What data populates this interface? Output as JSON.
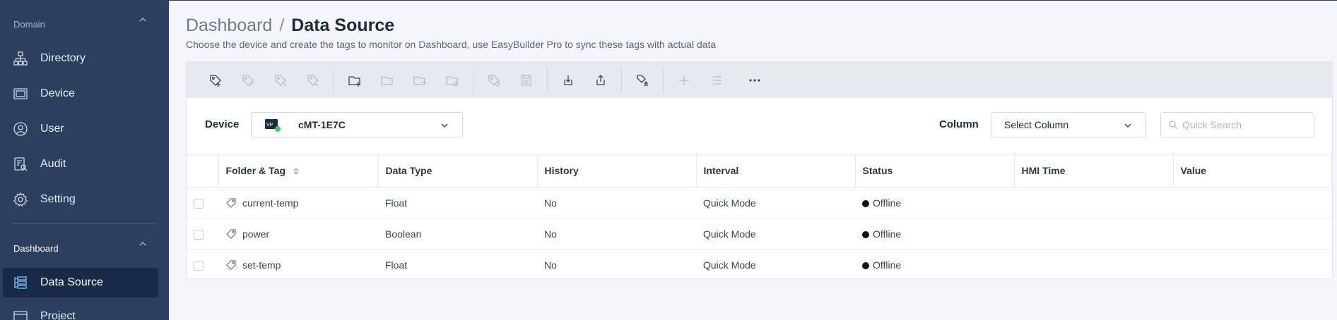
{
  "sidebar": {
    "domain_section": "Domain",
    "dashboard_section": "Dashboard",
    "items": [
      {
        "label": "Directory",
        "icon": "directory-icon"
      },
      {
        "label": "Device",
        "icon": "device-icon"
      },
      {
        "label": "User",
        "icon": "user-icon"
      },
      {
        "label": "Audit",
        "icon": "audit-icon"
      },
      {
        "label": "Setting",
        "icon": "gear-icon"
      }
    ],
    "dashboard_items": [
      {
        "label": "Data Source",
        "icon": "data-source-icon",
        "active": true
      },
      {
        "label": "Project",
        "icon": "project-icon"
      }
    ]
  },
  "header": {
    "breadcrumb_root": "Dashboard",
    "breadcrumb_sep": "/",
    "title": "Data Source",
    "subtitle": "Choose the device and create the tags to monitor on Dashboard, use EasyBuilder Pro to sync these tags with actual data"
  },
  "filters": {
    "device_label": "Device",
    "device_value": "cMT-1E7C",
    "device_status_color": "#3ccf6a",
    "column_label": "Column",
    "column_value": "Select Column",
    "search_placeholder": "Quick Search"
  },
  "table": {
    "headers": [
      "Folder & Tag",
      "Data Type",
      "History",
      "Interval",
      "Status",
      "HMI Time",
      "Value"
    ],
    "rows": [
      {
        "tag": "current-temp",
        "type": "Float",
        "history": "No",
        "interval": "Quick Mode",
        "status": "Offline",
        "hmi_time": "",
        "value": ""
      },
      {
        "tag": "power",
        "type": "Boolean",
        "history": "No",
        "interval": "Quick Mode",
        "status": "Offline",
        "hmi_time": "",
        "value": ""
      },
      {
        "tag": "set-temp",
        "type": "Float",
        "history": "No",
        "interval": "Quick Mode",
        "status": "Offline",
        "hmi_time": "",
        "value": ""
      }
    ]
  },
  "colors": {
    "sidebar_bg": "#2b3f5e",
    "sidebar_active": "#182a45",
    "toolbar_bg": "#e6e9ee"
  }
}
